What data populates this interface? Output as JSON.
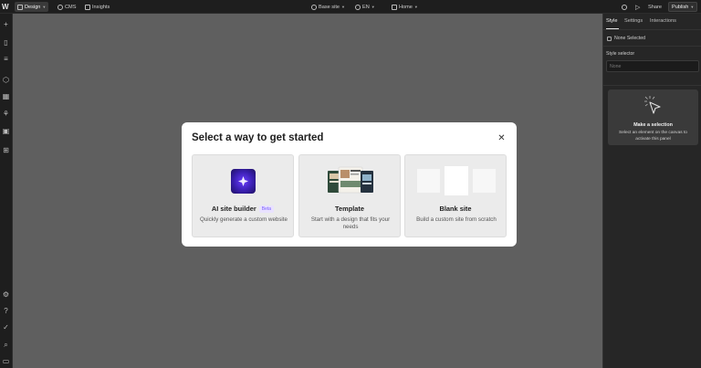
{
  "topbar": {
    "logo": "W",
    "design": "Design",
    "cms": "CMS",
    "insights": "Insights",
    "base_site": "Base site",
    "locale": "EN",
    "page": "Home",
    "share": "Share",
    "publish": "Publish"
  },
  "right_panel": {
    "tabs": [
      "Style",
      "Settings",
      "Interactions"
    ],
    "none_selected": "None Selected",
    "style_selector_label": "Style selector",
    "style_selector_placeholder": "None",
    "make_selection_title": "Make a selection",
    "make_selection_desc": "Select an element on the canvas to activate this panel"
  },
  "modal": {
    "title": "Select a way to get started",
    "options": [
      {
        "title": "AI site builder",
        "badge": "Beta",
        "desc": "Quickly generate a custom website"
      },
      {
        "title": "Template",
        "desc": "Start with a design that fits your needs"
      },
      {
        "title": "Blank site",
        "desc": "Build a custom site from scratch"
      }
    ]
  },
  "colors": {
    "canvas": "#5f5f5f",
    "chrome": "#1e1e1e",
    "panel": "#262626",
    "accent_purple": "#6a3cff"
  }
}
